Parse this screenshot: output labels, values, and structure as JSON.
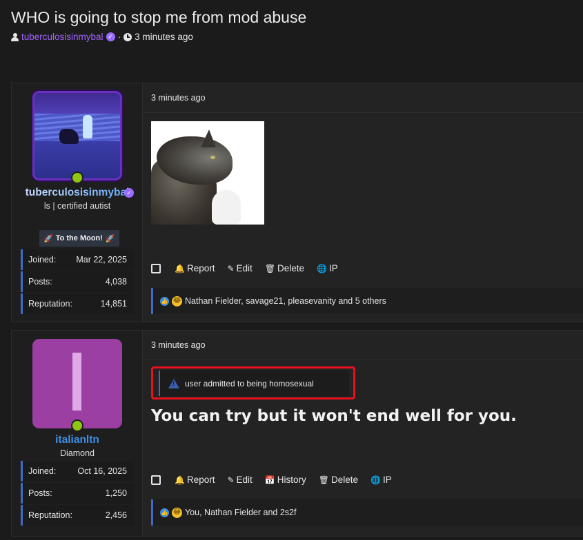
{
  "thread": {
    "title": "WHO is going to stop me from mod abuse",
    "author": "tuberculosisinmybal",
    "separator": "·",
    "time": "3 minutes ago"
  },
  "posts": [
    {
      "user": {
        "name": "tuberculosisinmybal",
        "title": "ls | certified autist",
        "banner": "To the Moon!",
        "banner_icon": "🚀",
        "online": true,
        "stats": [
          {
            "label": "Joined:",
            "value": "Mar 22, 2025"
          },
          {
            "label": "Posts:",
            "value": "4,038"
          },
          {
            "label": "Reputation:",
            "value": "14,851"
          }
        ]
      },
      "date": "3 minutes ago",
      "content_image": "cat-image",
      "actions": [
        {
          "icon": "bell-icon",
          "label": "Report"
        },
        {
          "icon": "pencil-icon",
          "label": "Edit"
        },
        {
          "icon": "trash-icon",
          "label": "Delete"
        },
        {
          "icon": "globe-icon",
          "label": "IP"
        }
      ],
      "reactions": "Nathan Fielder, savage21, pleasevanity and 5 others"
    },
    {
      "user": {
        "name": "italianltn",
        "title": "Diamond",
        "online": true,
        "stats": [
          {
            "label": "Joined:",
            "value": "Oct 16, 2025"
          },
          {
            "label": "Posts:",
            "value": "1,250"
          },
          {
            "label": "Reputation:",
            "value": "2,456"
          }
        ]
      },
      "date": "3 minutes ago",
      "warning": "user admitted to being homosexual",
      "message": "You can try but it won't end well for you.",
      "actions": [
        {
          "icon": "bell-icon",
          "label": "Report"
        },
        {
          "icon": "pencil-icon",
          "label": "Edit"
        },
        {
          "icon": "calendar-icon",
          "label": "History"
        },
        {
          "icon": "trash-icon",
          "label": "Delete"
        },
        {
          "icon": "globe-icon",
          "label": "IP"
        }
      ],
      "reactions": "You, Nathan Fielder and 2s2f"
    }
  ],
  "colors": {
    "accent": "#3f6bc6",
    "author": "#a063ff",
    "online": "#8fc614",
    "warning_border": "#e8111c"
  }
}
